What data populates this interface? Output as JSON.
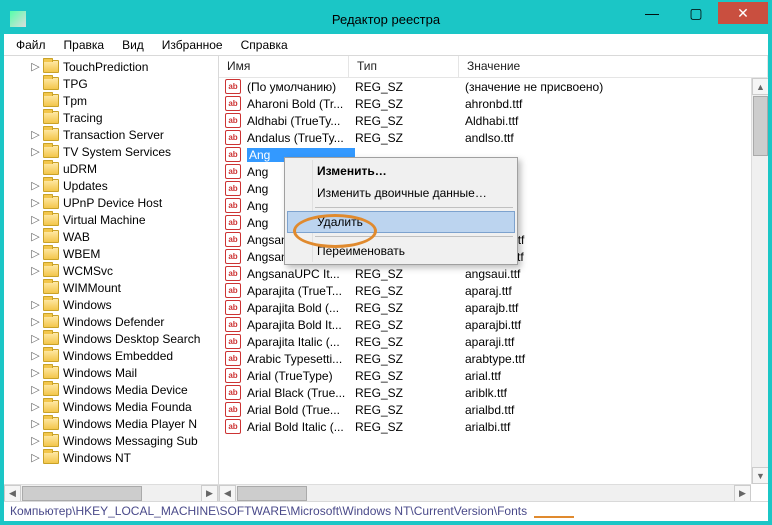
{
  "window": {
    "title": "Редактор реестра"
  },
  "win_controls": {
    "min": "—",
    "max": "▢",
    "close": "✕"
  },
  "menu": {
    "file": "Файл",
    "edit": "Правка",
    "view": "Вид",
    "fav": "Избранное",
    "help": "Справка"
  },
  "tree": {
    "items": [
      {
        "exp": "▷",
        "label": "TouchPrediction"
      },
      {
        "exp": "",
        "label": "TPG"
      },
      {
        "exp": "",
        "label": "Tpm"
      },
      {
        "exp": "",
        "label": "Tracing"
      },
      {
        "exp": "▷",
        "label": "Transaction Server"
      },
      {
        "exp": "▷",
        "label": "TV System Services"
      },
      {
        "exp": "",
        "label": "uDRM"
      },
      {
        "exp": "▷",
        "label": "Updates"
      },
      {
        "exp": "▷",
        "label": "UPnP Device Host"
      },
      {
        "exp": "▷",
        "label": "Virtual Machine"
      },
      {
        "exp": "▷",
        "label": "WAB"
      },
      {
        "exp": "▷",
        "label": "WBEM"
      },
      {
        "exp": "▷",
        "label": "WCMSvc"
      },
      {
        "exp": "",
        "label": "WIMMount"
      },
      {
        "exp": "▷",
        "label": "Windows"
      },
      {
        "exp": "▷",
        "label": "Windows Defender"
      },
      {
        "exp": "▷",
        "label": "Windows Desktop Search"
      },
      {
        "exp": "▷",
        "label": "Windows Embedded"
      },
      {
        "exp": "▷",
        "label": "Windows Mail"
      },
      {
        "exp": "▷",
        "label": "Windows Media Device"
      },
      {
        "exp": "▷",
        "label": "Windows Media Founda"
      },
      {
        "exp": "▷",
        "label": "Windows Media Player N"
      },
      {
        "exp": "▷",
        "label": "Windows Messaging Sub"
      },
      {
        "exp": "▷",
        "label": "Windows NT"
      }
    ]
  },
  "columns": {
    "name": "Имя",
    "type": "Тип",
    "value": "Значение"
  },
  "rows": [
    {
      "name": "(По умолчанию)",
      "type": "REG_SZ",
      "value": "(значение не присвоено)"
    },
    {
      "name": "Aharoni Bold (Tr...",
      "type": "REG_SZ",
      "value": "ahronbd.ttf"
    },
    {
      "name": "Aldhabi (TrueTy...",
      "type": "REG_SZ",
      "value": "Aldhabi.ttf"
    },
    {
      "name": "Andalus (TrueTy...",
      "type": "REG_SZ",
      "value": "andlso.ttf"
    },
    {
      "name": "Ang",
      "type": "",
      "value": "",
      "sel": true
    },
    {
      "name": "Ang",
      "type": "",
      "value": ""
    },
    {
      "name": "Ang",
      "type": "",
      "value": ""
    },
    {
      "name": "Ang",
      "type": "",
      "value": ""
    },
    {
      "name": "Ang",
      "type": "",
      "value": ""
    },
    {
      "name": "AngsanaUPC b...",
      "type": "REG_SZ",
      "value": "angsaub.ttf"
    },
    {
      "name": "AngsanaUPC Bo...",
      "type": "REG_SZ",
      "value": "angsauz.ttf"
    },
    {
      "name": "AngsanaUPC It...",
      "type": "REG_SZ",
      "value": "angsaui.ttf"
    },
    {
      "name": "Aparajita (TrueT...",
      "type": "REG_SZ",
      "value": "aparaj.ttf"
    },
    {
      "name": "Aparajita Bold (...",
      "type": "REG_SZ",
      "value": "aparajb.ttf"
    },
    {
      "name": "Aparajita Bold It...",
      "type": "REG_SZ",
      "value": "aparajbi.ttf"
    },
    {
      "name": "Aparajita Italic (...",
      "type": "REG_SZ",
      "value": "aparaji.ttf"
    },
    {
      "name": "Arabic Typesetti...",
      "type": "REG_SZ",
      "value": "arabtype.ttf"
    },
    {
      "name": "Arial (TrueType)",
      "type": "REG_SZ",
      "value": "arial.ttf"
    },
    {
      "name": "Arial Black (True...",
      "type": "REG_SZ",
      "value": "ariblk.ttf"
    },
    {
      "name": "Arial Bold (True...",
      "type": "REG_SZ",
      "value": "arialbd.ttf"
    },
    {
      "name": "Arial Bold Italic (...",
      "type": "REG_SZ",
      "value": "arialbi.ttf"
    }
  ],
  "context_menu": {
    "modify": "Изменить…",
    "modify_binary": "Изменить двоичные данные…",
    "delete": "Удалить",
    "rename": "Переименовать"
  },
  "statusbar": {
    "path": "Компьютер\\HKEY_LOCAL_MACHINE\\SOFTWARE\\Microsoft\\Windows NT\\CurrentVersion\\Fonts"
  },
  "icon_label": "ab"
}
